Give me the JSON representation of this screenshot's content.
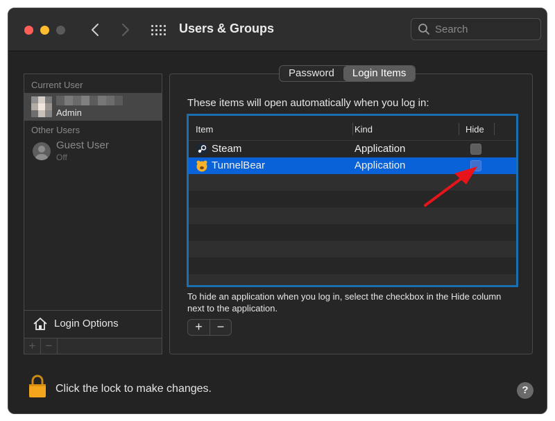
{
  "window": {
    "title": "Users & Groups",
    "search_placeholder": "Search"
  },
  "sidebar": {
    "current_user_heading": "Current User",
    "current_user_role": "Admin",
    "other_users_heading": "Other Users",
    "guest": {
      "name": "Guest User",
      "status": "Off"
    },
    "login_options_label": "Login Options",
    "add_label": "+",
    "remove_label": "−"
  },
  "tabs": [
    {
      "label": "Password",
      "active": false
    },
    {
      "label": "Login Items",
      "active": true
    }
  ],
  "main": {
    "intro": "These items will open automatically when you log in:",
    "columns": {
      "item": "Item",
      "kind": "Kind",
      "hide": "Hide"
    },
    "rows": [
      {
        "name": "Steam",
        "kind": "Application",
        "icon": "steam-icon",
        "hide": false,
        "selected": false
      },
      {
        "name": "TunnelBear",
        "kind": "Application",
        "icon": "tunnelbear-icon",
        "hide": false,
        "selected": true
      }
    ],
    "help_text": "To hide an application when you log in, select the checkbox in the Hide column next to the application.",
    "add_label": "+",
    "remove_label": "−"
  },
  "footer": {
    "lock_text": "Click the lock to make changes.",
    "help_label": "?"
  },
  "colors": {
    "selection": "#0a62d8",
    "table_border": "#1a6fb0",
    "annotation_arrow": "#e8141b",
    "lock_icon": "#f3a51c"
  }
}
